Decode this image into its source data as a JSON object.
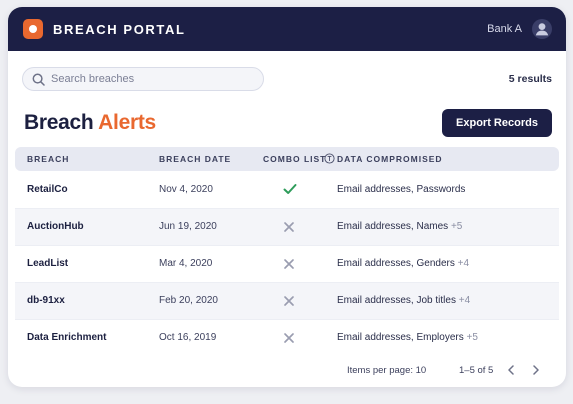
{
  "header": {
    "brand": "BREACH PORTAL",
    "user": "Bank A",
    "logo_color": "#e9682f",
    "bar_color": "#1c1f45"
  },
  "search": {
    "placeholder": "Search breaches",
    "value": ""
  },
  "results_label": "5 results",
  "page_title": {
    "part1": "Breach",
    "part2": "Alerts"
  },
  "export_button": "Export Records",
  "table": {
    "columns": [
      "BREACH",
      "BREACH DATE",
      "COMBO LIST",
      "DATA COMPROMISED"
    ],
    "rows": [
      {
        "name": "RetailCo",
        "date": "Nov 4, 2020",
        "combo": true,
        "data": "Email addresses, Passwords",
        "more": ""
      },
      {
        "name": "AuctionHub",
        "date": "Jun 19, 2020",
        "combo": false,
        "data": "Email addresses, Names",
        "more": "+5"
      },
      {
        "name": "LeadList",
        "date": "Mar 4, 2020",
        "combo": false,
        "data": "Email addresses, Genders",
        "more": "+4"
      },
      {
        "name": "db-91xx",
        "date": "Feb 20, 2020",
        "combo": false,
        "data": "Email addresses, Job titles",
        "more": "+4"
      },
      {
        "name": "Data Enrichment",
        "date": "Oct 16, 2019",
        "combo": false,
        "data": "Email addresses, Employers",
        "more": "+5"
      }
    ]
  },
  "pagination": {
    "items_per_page": "Items per page: 10",
    "range": "1–5 of 5"
  },
  "icons": {
    "check_color": "#2e9c5a",
    "cross_color": "#9a9db0"
  }
}
